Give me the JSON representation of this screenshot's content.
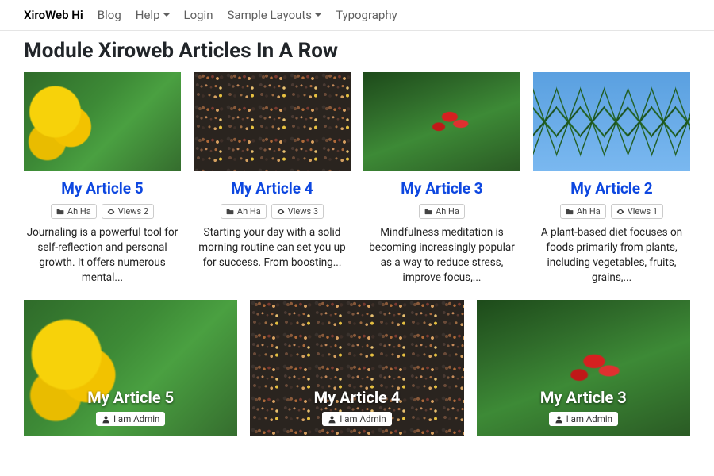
{
  "nav": {
    "brand": "XiroWeb Hi",
    "items": [
      "Blog",
      "Help",
      "Login",
      "Sample Layouts",
      "Typography"
    ],
    "dropdown_indices": [
      1,
      3
    ]
  },
  "page_title": "Module Xiroweb Articles In A Row",
  "row1": [
    {
      "title": "My Article 5",
      "category": "Ah Ha",
      "views": "Views 2",
      "excerpt": "Journaling is a powerful tool for self-reflection and personal growth. It offers numerous mental...",
      "image_class": "img-yellow"
    },
    {
      "title": "My Article 4",
      "category": "Ah Ha",
      "views": "Views 3",
      "excerpt": "Starting your day with a solid morning routine can set you up for success. From boosting...",
      "image_class": "img-mosaic"
    },
    {
      "title": "My Article 3",
      "category": "Ah Ha",
      "views": null,
      "excerpt": "Mindfulness meditation is becoming increasingly popular as a way to reduce stress, improve focus,...",
      "image_class": "img-redleaf"
    },
    {
      "title": "My Article 2",
      "category": "Ah Ha",
      "views": "Views 1",
      "excerpt": "A plant-based diet focuses on foods primarily from plants, including vegetables, fruits, grains,...",
      "image_class": "img-palm"
    }
  ],
  "row2": [
    {
      "title": "My Article 5",
      "author": "I am Admin",
      "image_class": "img-yellow"
    },
    {
      "title": "My Article 4",
      "author": "I am Admin",
      "image_class": "img-mosaic"
    },
    {
      "title": "My Article 3",
      "author": "I am Admin",
      "image_class": "img-redleaf"
    }
  ]
}
